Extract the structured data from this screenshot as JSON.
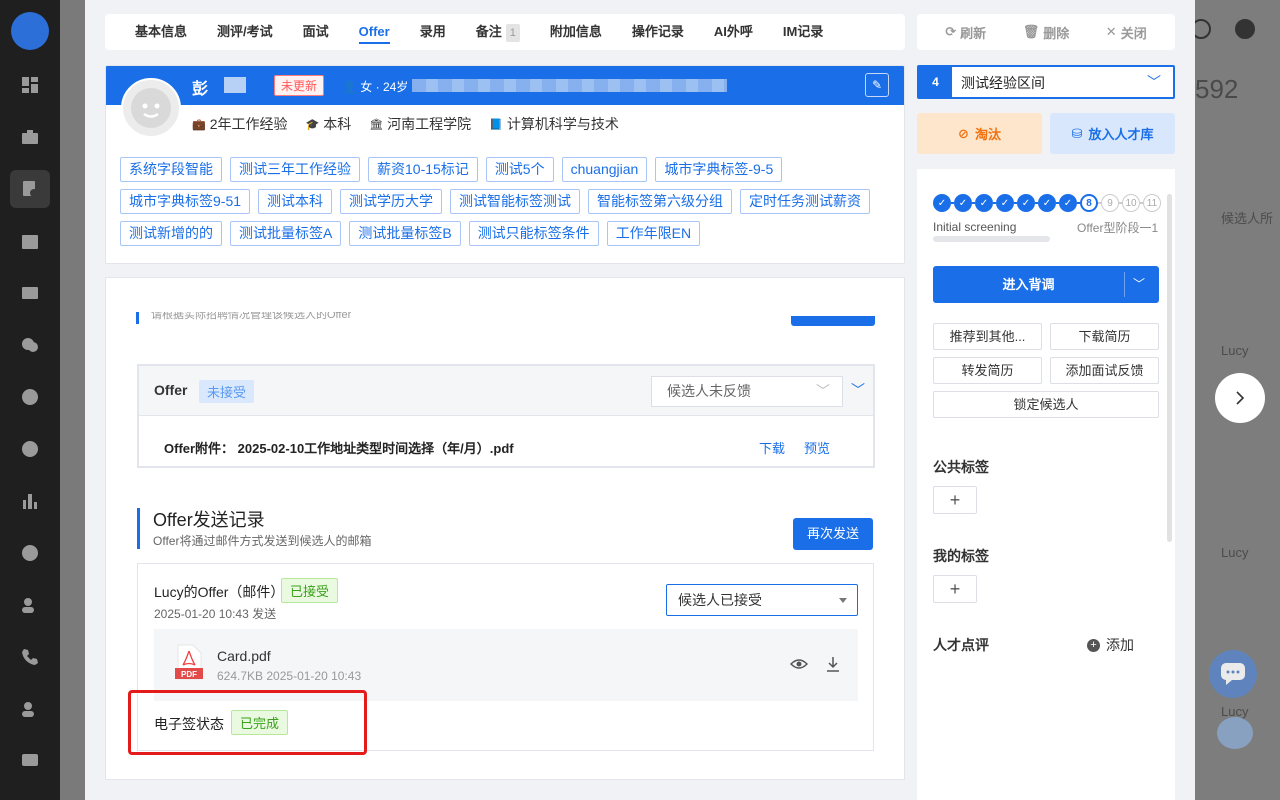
{
  "tabs": [
    {
      "label": "基本信息"
    },
    {
      "label": "测评/考试"
    },
    {
      "label": "面试"
    },
    {
      "label": "Offer"
    },
    {
      "label": "录用"
    },
    {
      "label": "备注",
      "count": "1"
    },
    {
      "label": "附加信息"
    },
    {
      "label": "操作记录"
    },
    {
      "label": "AI外呼"
    },
    {
      "label": "IM记录"
    }
  ],
  "active_tab": "Offer",
  "header_actions": {
    "refresh": "刷新",
    "delete": "删除",
    "close": "关闭"
  },
  "candidate": {
    "name": "彭",
    "update_badge": "未更新",
    "gender_age": "女 · 24岁",
    "experience": "2年工作经验",
    "education": "本科",
    "school": "河南工程学院",
    "major": "计算机科学与技术"
  },
  "tags": [
    "系统字段智能",
    "测试三年工作经验",
    "薪资10-15标记",
    "测试5个",
    "chuangjian",
    "城市字典标签-9-5",
    "城市字典标签9-51",
    "测试本科",
    "测试学历大学",
    "测试智能标签测试",
    "智能标签第六级分组",
    "定时任务测试薪资",
    "测试新增的的",
    "测试批量标签A",
    "测试批量标签B",
    "测试只能标签条件",
    "工作年限EN"
  ],
  "offer_section": {
    "hint": "请根据实际招聘情况管理该候选人的Offer",
    "label": "Offer",
    "status": "未接受",
    "feedback_select": "候选人未反馈",
    "attachment": "Offer附件：  2025-02-10工作地址类型时间选择（年/月）.pdf",
    "download": "下载",
    "preview": "预览"
  },
  "send_record": {
    "title": "Offer发送记录",
    "subtitle": "Offer将通过邮件方式发送到候选人的邮箱",
    "resend": "再次发送",
    "item_title": "Lucy的Offer（邮件）",
    "item_status": "已接受",
    "item_date": "2025-01-20 10:43 发送",
    "item_select": "候选人已接受",
    "file_name": "Card.pdf",
    "file_meta": "624.7KB 2025-01-20 10:43",
    "pdf_label": "PDF",
    "esign_label": "电子签状态",
    "esign_status": "已完成"
  },
  "right_panel": {
    "stage_no": "4",
    "stage_select": "测试经验区间",
    "reject": "淘汰",
    "talent_pool": "放入人才库",
    "steps": {
      "done": 7,
      "current": "8",
      "future": [
        "9",
        "10",
        "11"
      ]
    },
    "stage_label_1": "Initial screening",
    "stage_label_2": "Offer型阶段一1",
    "enter": "进入背调",
    "buttons": [
      "推荐到其他...",
      "下载简历",
      "转发简历",
      "添加面试反馈",
      "锁定候选人"
    ],
    "public_tags": "公共标签",
    "my_tags": "我的标签",
    "talent_review": "人才点评",
    "add": "添加"
  },
  "background": {
    "number": "592",
    "candidate_col": "候选人所",
    "names": [
      "Lucy",
      "Lucy",
      "Lucy"
    ]
  },
  "colors": {
    "primary": "#1a6fe8",
    "success": "#3aa11b",
    "warning": "#f0710e",
    "danger": "#e41b1b"
  }
}
